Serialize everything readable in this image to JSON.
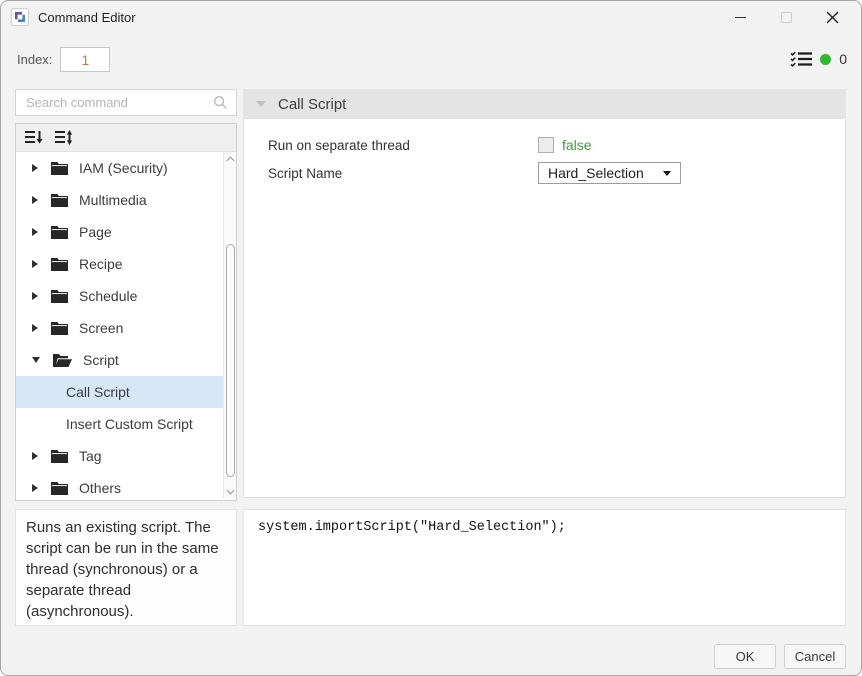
{
  "window": {
    "title": "Command Editor"
  },
  "toolbar": {
    "index_label": "Index:",
    "index_value": "1",
    "status_count": "0"
  },
  "sidebar": {
    "search_placeholder": "Search command",
    "tree": [
      {
        "label": "IAM (Security)",
        "type": "folder",
        "state": "collapsed"
      },
      {
        "label": "Multimedia",
        "type": "folder",
        "state": "collapsed"
      },
      {
        "label": "Page",
        "type": "folder",
        "state": "collapsed"
      },
      {
        "label": "Recipe",
        "type": "folder",
        "state": "collapsed"
      },
      {
        "label": "Schedule",
        "type": "folder",
        "state": "collapsed"
      },
      {
        "label": "Screen",
        "type": "folder",
        "state": "collapsed"
      },
      {
        "label": "Script",
        "type": "folder",
        "state": "expanded"
      },
      {
        "label": "Call Script",
        "type": "command",
        "selected": true
      },
      {
        "label": "Insert Custom Script",
        "type": "command",
        "selected": false
      },
      {
        "label": "Tag",
        "type": "folder",
        "state": "collapsed"
      },
      {
        "label": "Others",
        "type": "folder",
        "state": "collapsed"
      }
    ],
    "description": "Runs an existing script. The script can be run in the same thread (synchronous) or a separate thread (asynchronous)."
  },
  "editor": {
    "header": "Call Script",
    "run_on_separate_thread": {
      "label": "Run on separate thread",
      "value": "false",
      "checked": false
    },
    "script_name": {
      "label": "Script Name",
      "value": "Hard_Selection"
    },
    "code": "system.importScript(\"Hard_Selection\");"
  },
  "footer": {
    "ok_label": "OK",
    "cancel_label": "Cancel"
  },
  "icons": {
    "app-logo": "interlocking purple/blue brackets",
    "minimize": "horizontal bar",
    "maximize": "square outline (disabled)",
    "close": "x cross",
    "checklist": "three lines with checkmarks",
    "status-dot": "green filled circle",
    "search": "magnifier",
    "collapse-all": "list lines with down arrow",
    "expand-all": "list lines with up-down arrows",
    "folder-closed": "solid dark folder",
    "folder-open": "solid dark open folder",
    "chevron-right": "collapsed expander triangle",
    "chevron-down": "expanded expander triangle",
    "dropdown-arrow": "solid down triangle"
  },
  "colors": {
    "selection_blue": "#d6e8f7",
    "value_green": "#3f9c35",
    "index_orange": "#d9782d",
    "status_green": "#2eb82e",
    "header_gray": "#e4e4e4",
    "folder_dark": "#262626"
  }
}
